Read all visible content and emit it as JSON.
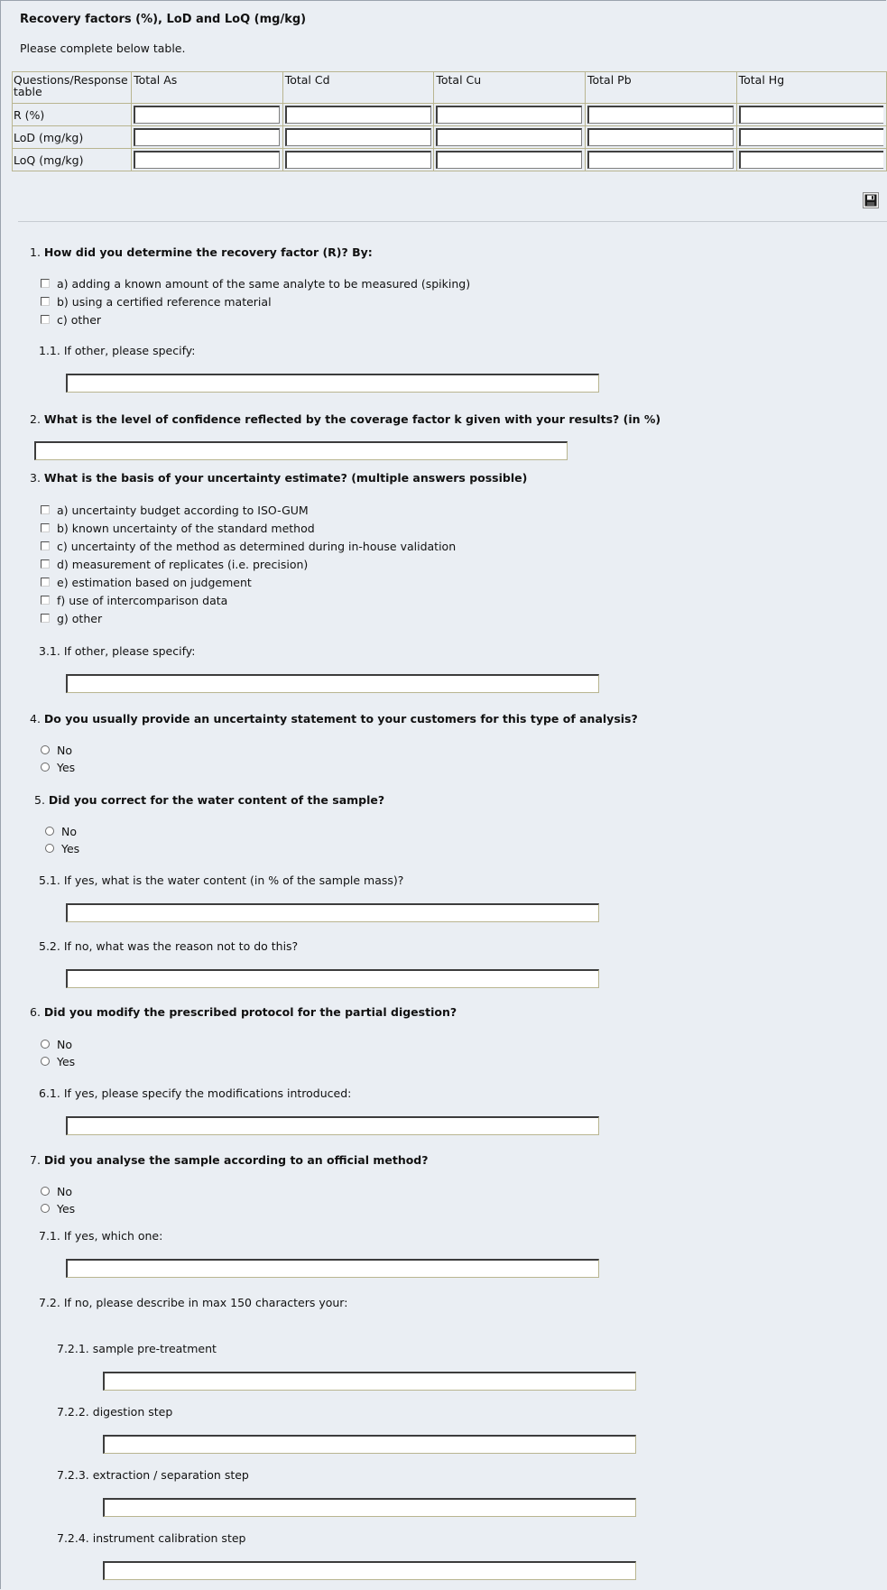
{
  "section": {
    "title": "Recovery factors (%), LoD and LoQ (mg/kg)",
    "instruction": "Please complete below table."
  },
  "table": {
    "corner_label": "Questions/Response table",
    "columns": [
      "Total As",
      "Total Cd",
      "Total Cu",
      "Total Pb",
      "Total Hg"
    ],
    "rows": [
      "R (%)",
      "LoD (mg/kg)",
      "LoQ (mg/kg)"
    ]
  },
  "q1": {
    "number": "1.",
    "text": "How did you determine the recovery factor (R)? By:",
    "options": [
      "a) adding a known amount of the same analyte to be measured (spiking)",
      "b) using a certified reference material",
      "c) other"
    ],
    "sub": {
      "number": "1.1.",
      "text": "If other, please specify:"
    }
  },
  "q2": {
    "number": "2.",
    "text": "What is the level of confidence reflected by the coverage factor k given with your results? (in %)"
  },
  "q3": {
    "number": "3.",
    "text": "What is the basis of your uncertainty estimate? (multiple answers possible)",
    "options": [
      "a) uncertainty budget according to ISO-GUM",
      "b) known uncertainty of the standard method",
      "c) uncertainty of the method as determined during in-house validation",
      "d) measurement of replicates (i.e. precision)",
      "e) estimation based on judgement",
      "f) use of intercomparison data",
      "g) other"
    ],
    "sub": {
      "number": "3.1.",
      "text": "If other, please specify:"
    }
  },
  "q4": {
    "number": "4.",
    "text": "Do you usually provide an uncertainty statement to your customers for this type of analysis?",
    "options": [
      "No",
      "Yes"
    ]
  },
  "q5": {
    "number": "5.",
    "text": "Did you correct for the water content of the sample?",
    "options": [
      "No",
      "Yes"
    ],
    "sub1": {
      "number": "5.1.",
      "text": "If yes, what is the water content (in % of the sample mass)?"
    },
    "sub2": {
      "number": "5.2.",
      "text": "If no, what was the reason not to do this?"
    }
  },
  "q6": {
    "number": "6.",
    "text": "Did you modify the prescribed protocol for the partial digestion?",
    "options": [
      "No",
      "Yes"
    ],
    "sub": {
      "number": "6.1.",
      "text": "If yes, please specify the modifications introduced:"
    }
  },
  "q7": {
    "number": "7.",
    "text": "Did you analyse the sample according to an official method?",
    "options": [
      "No",
      "Yes"
    ],
    "sub1": {
      "number": "7.1.",
      "text": "If yes, which one:"
    },
    "sub2": {
      "number": "7.2.",
      "text": "If no, please describe in max 150 characters your:"
    },
    "steps": [
      {
        "number": "7.2.1.",
        "text": "sample pre-treatment"
      },
      {
        "number": "7.2.2.",
        "text": "digestion step"
      },
      {
        "number": "7.2.3.",
        "text": "extraction / separation step"
      },
      {
        "number": "7.2.4.",
        "text": "instrument calibration step"
      }
    ]
  },
  "icons": {
    "save": "floppy-disk-icon"
  }
}
